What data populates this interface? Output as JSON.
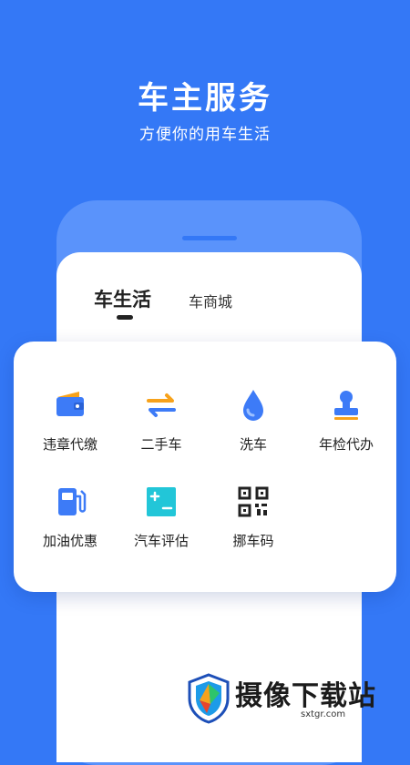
{
  "hero": {
    "title": "车主服务",
    "subtitle": "方便你的用车生活"
  },
  "tabs": [
    {
      "label": "车生活",
      "active": true
    },
    {
      "label": "车商城",
      "active": false
    }
  ],
  "services": [
    {
      "label": "违章代缴",
      "icon": "wallet-icon"
    },
    {
      "label": "二手车",
      "icon": "exchange-arrows-icon"
    },
    {
      "label": "洗车",
      "icon": "water-drop-icon"
    },
    {
      "label": "年检代办",
      "icon": "stamp-icon"
    },
    {
      "label": "加油优惠",
      "icon": "fuel-pump-icon"
    },
    {
      "label": "汽车评估",
      "icon": "plus-minus-icon"
    },
    {
      "label": "挪车码",
      "icon": "qr-code-icon"
    }
  ],
  "watermark": {
    "text": "摄像下载站",
    "url": "sxtgr.com"
  },
  "colors": {
    "background": "#3478f6",
    "phone_frame": "#5a93fb",
    "icon_blue": "#3d7bf7",
    "icon_orange": "#f7a21b",
    "icon_teal": "#22c6d8"
  }
}
